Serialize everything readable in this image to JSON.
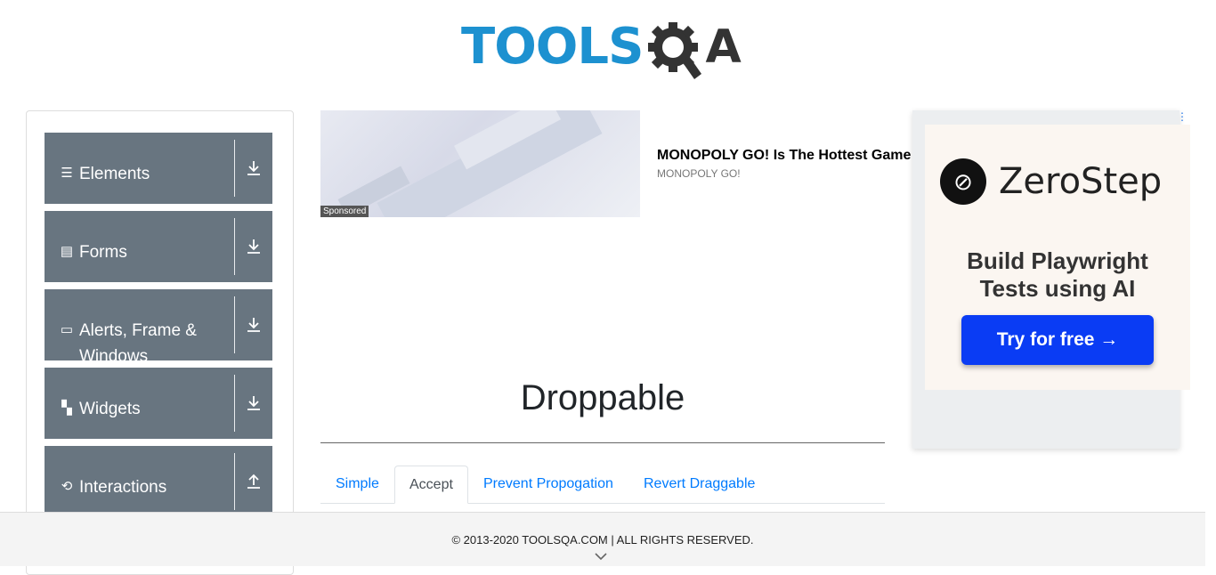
{
  "header": {
    "logo_tools": "TOOLS",
    "logo_q": "Q",
    "logo_a": "A"
  },
  "sidebar": {
    "groups": [
      {
        "label": "Elements",
        "icon": "list-icon",
        "toggle": "download-icon"
      },
      {
        "label": "Forms",
        "icon": "form-icon",
        "toggle": "download-icon"
      },
      {
        "label": "Alerts, Frame & Windows",
        "icon": "window-icon",
        "toggle": "download-icon"
      },
      {
        "label": "Widgets",
        "icon": "widgets-icon",
        "toggle": "download-icon"
      },
      {
        "label": "Interactions",
        "icon": "interactions-icon",
        "toggle": "upload-icon"
      }
    ]
  },
  "ad": {
    "sponsored": "Sponsored",
    "title": "MONOPOLY GO! Is The Hottest Game",
    "subtitle": "MONOPOLY GO!"
  },
  "banner": {
    "brand": "ZeroStep",
    "tagline_line1": "Build Playwright",
    "tagline_line2": "Tests using AI",
    "cta": "Try for free →"
  },
  "main": {
    "title": "Droppable",
    "tabs": [
      {
        "label": "Simple",
        "active": false
      },
      {
        "label": "Accept",
        "active": true
      },
      {
        "label": "Prevent Propogation",
        "active": false
      },
      {
        "label": "Revert Draggable",
        "active": false
      }
    ]
  },
  "footer": {
    "text": "© 2013-2020 TOOLSQA.COM | ALL RIGHTS RESERVED."
  },
  "colors": {
    "sidebar_group": "#687580",
    "link": "#007bff",
    "logo_blue": "#1d91d0",
    "cta_blue": "#0a3cf4"
  }
}
